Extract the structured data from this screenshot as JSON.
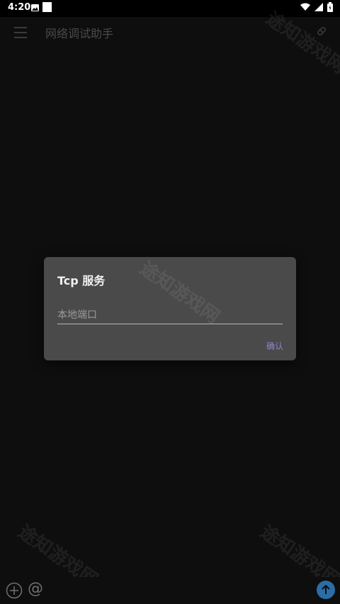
{
  "status_bar": {
    "time": "4:20"
  },
  "app_bar": {
    "title": "网络调试助手"
  },
  "dialog": {
    "title": "Tcp 服务",
    "port_placeholder": "本地端口",
    "port_value": "",
    "confirm_label": "确认"
  },
  "bottom_bar": {
    "at_label": "@"
  },
  "watermark": {
    "text": "途知游戏网"
  },
  "colors": {
    "accent": "#8a86c9",
    "send": "#2b6ea7",
    "dialog_bg": "#4a4a4a"
  }
}
